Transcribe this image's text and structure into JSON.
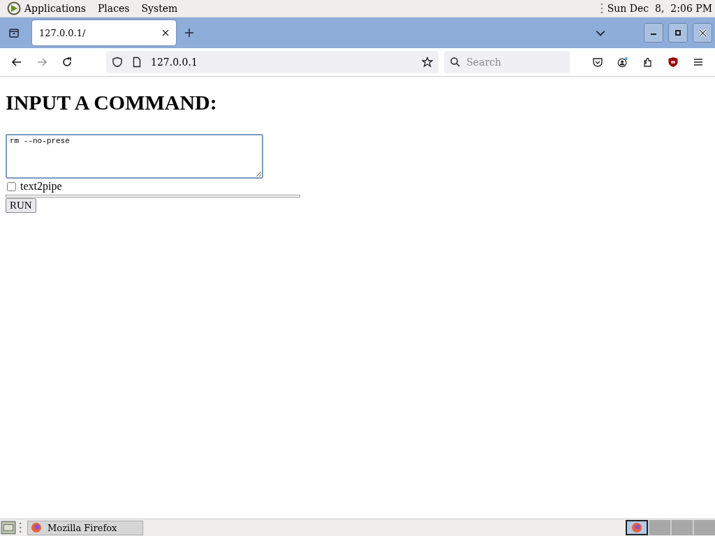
{
  "menu_bar": {
    "items": [
      "Applications",
      "Places",
      "System"
    ],
    "clock": "Sun Dec  8,  2:06 PM"
  },
  "tabs": [
    {
      "label": "127.0.0.1/",
      "selected": true
    }
  ],
  "address_bar": {
    "url": "127.0.0.1"
  },
  "search": {
    "placeholder": "Search"
  },
  "page": {
    "heading": "INPUT A COMMAND:",
    "command": {
      "value": "rm --no-prese"
    },
    "checkbox": {
      "label": "text2pipe",
      "checked": false
    },
    "button": "RUN"
  },
  "taskbar": {
    "windows": [
      {
        "label": "Mozilla Firefox",
        "selected": false
      }
    ],
    "workspaces": [
      {
        "selected": true
      },
      {
        "selected": false
      },
      {
        "selected": false
      },
      {
        "selected": false
      }
    ]
  }
}
